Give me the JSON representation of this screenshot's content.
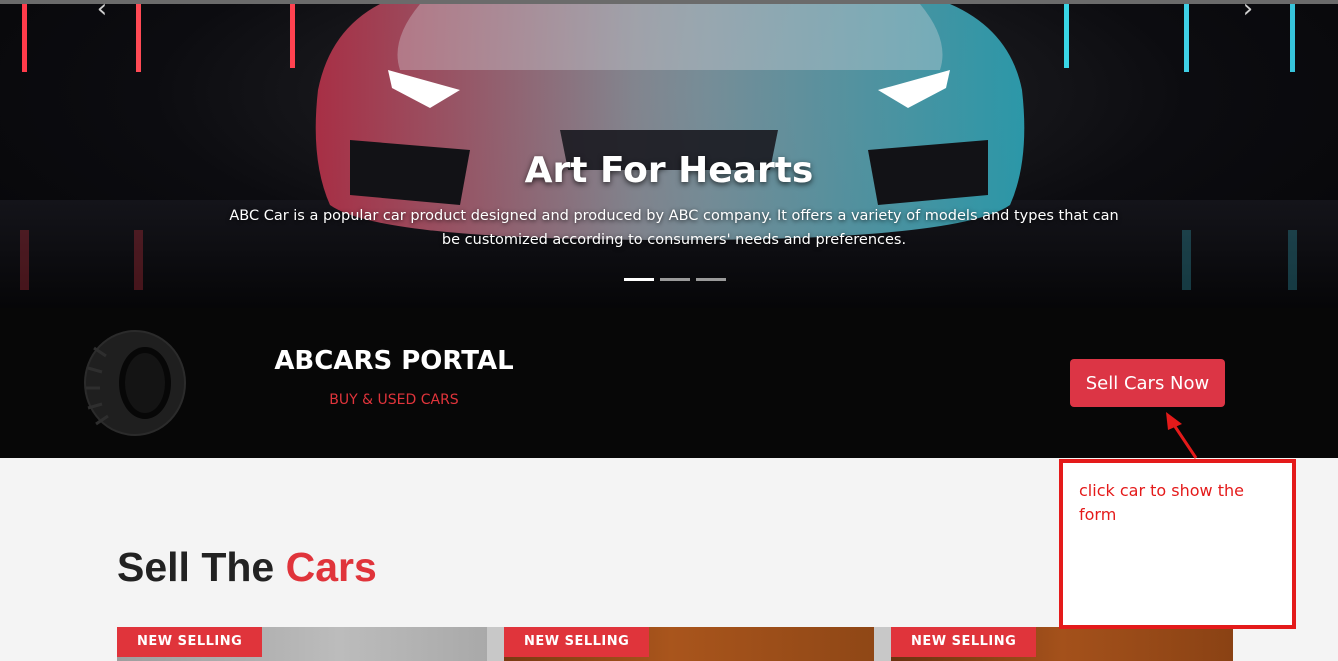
{
  "hero": {
    "title": "Art For Hearts",
    "description": "ABC Car is a popular car product designed and produced by ABC company. It offers a variety of models and types that can be customized according to consumers' needs and preferences.",
    "slides": 3,
    "active_slide": 1,
    "prev_icon": "chevron-left-icon",
    "next_icon": "chevron-right-icon"
  },
  "brand": {
    "title": "ABCARS PORTAL",
    "subtitle": "BUY & USED CARS",
    "icon": "tire-icon",
    "cta_label": "Sell Cars Now"
  },
  "annotation": {
    "text": "click car to show the form"
  },
  "section": {
    "title_main": "Sell The",
    "title_accent": "Cars"
  },
  "cards": [
    {
      "badge": "NEW SELLING"
    },
    {
      "badge": "NEW SELLING"
    },
    {
      "badge": "NEW SELLING"
    }
  ],
  "colors": {
    "accent": "#dc3545",
    "band_bg": "#070707",
    "page_bg": "#f4f4f4",
    "annotation": "#e41a1a"
  }
}
